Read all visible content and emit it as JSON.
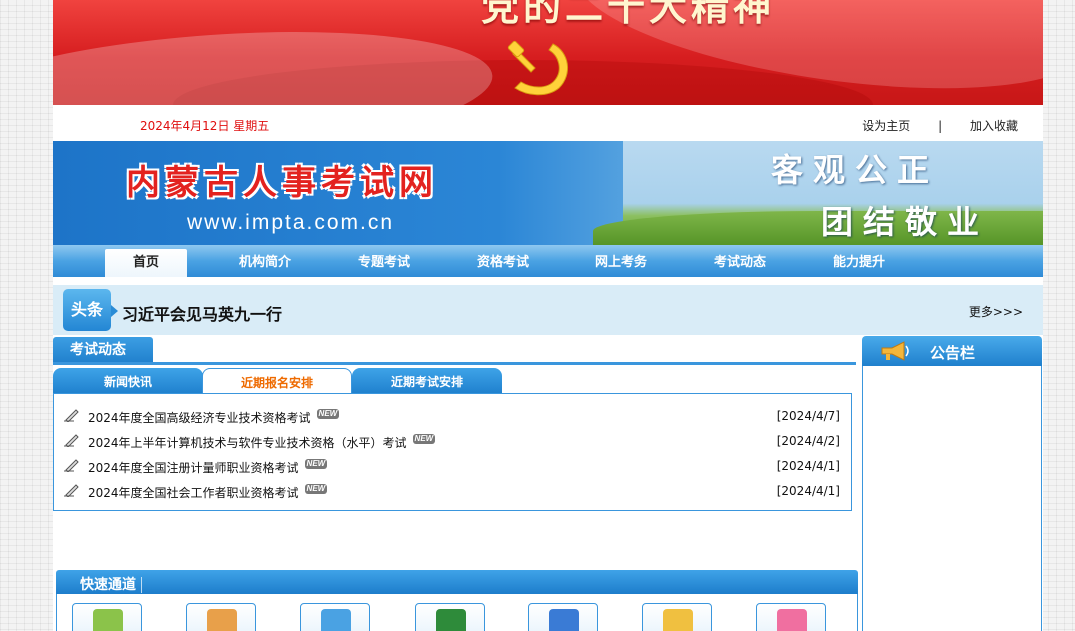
{
  "banner": {
    "slogan": "党的二十大精神"
  },
  "datebar": {
    "date": "2024年4月12日  星期五",
    "set_home": "设为主页",
    "separator": "|",
    "add_favorite": "加入收藏"
  },
  "header": {
    "site_title": "内蒙古人事考试网",
    "site_url": "www.impta.com.cn",
    "motto_1": "客观公正",
    "motto_2": "团结敬业"
  },
  "nav": {
    "items": [
      {
        "label": "首页",
        "active": true
      },
      {
        "label": "机构简介",
        "active": false
      },
      {
        "label": "专题考试",
        "active": false
      },
      {
        "label": "资格考试",
        "active": false
      },
      {
        "label": "网上考务",
        "active": false
      },
      {
        "label": "考试动态",
        "active": false
      },
      {
        "label": "能力提升",
        "active": false
      }
    ]
  },
  "headline": {
    "tag": "头条",
    "text": "习近平会见马英九一行",
    "more": "更多>>>"
  },
  "exam_news": {
    "title": "考试动态",
    "tabs": [
      {
        "label": "新闻快讯",
        "active": false
      },
      {
        "label": "近期报名安排",
        "active": true
      },
      {
        "label": "近期考试安排",
        "active": false
      }
    ],
    "items": [
      {
        "title": "2024年度全国高级经济专业技术资格考试",
        "badge": "NEW",
        "date": "[2024/4/7]"
      },
      {
        "title": "2024年上半年计算机技术与软件专业技术资格（水平）考试",
        "badge": "NEW",
        "date": "[2024/4/2]"
      },
      {
        "title": "2024年度全国注册计量师职业资格考试",
        "badge": "NEW",
        "date": "[2024/4/1]"
      },
      {
        "title": "2024年度全国社会工作者职业资格考试",
        "badge": "NEW",
        "date": "[2024/4/1]"
      }
    ]
  },
  "quick_access": {
    "title": "快速通道",
    "tiles": [
      {
        "icon": "chart-icon",
        "color": "#8bc34a"
      },
      {
        "icon": "printer-icon",
        "color": "#e8a04a"
      },
      {
        "icon": "document-icon",
        "color": "#4aa2e3"
      },
      {
        "icon": "excel-icon",
        "color": "#2e8b3a"
      },
      {
        "icon": "monitor-icon",
        "color": "#3a7bd5"
      },
      {
        "icon": "certificate-icon",
        "color": "#f0c040"
      },
      {
        "icon": "user-icon",
        "color": "#f06fa0"
      }
    ]
  },
  "notice_board": {
    "title": "公告栏"
  },
  "colors": {
    "primary_blue": "#2f8bd6",
    "banner_red": "#d61d1f",
    "date_red": "#e01010",
    "active_tab_orange": "#ee6a00"
  }
}
